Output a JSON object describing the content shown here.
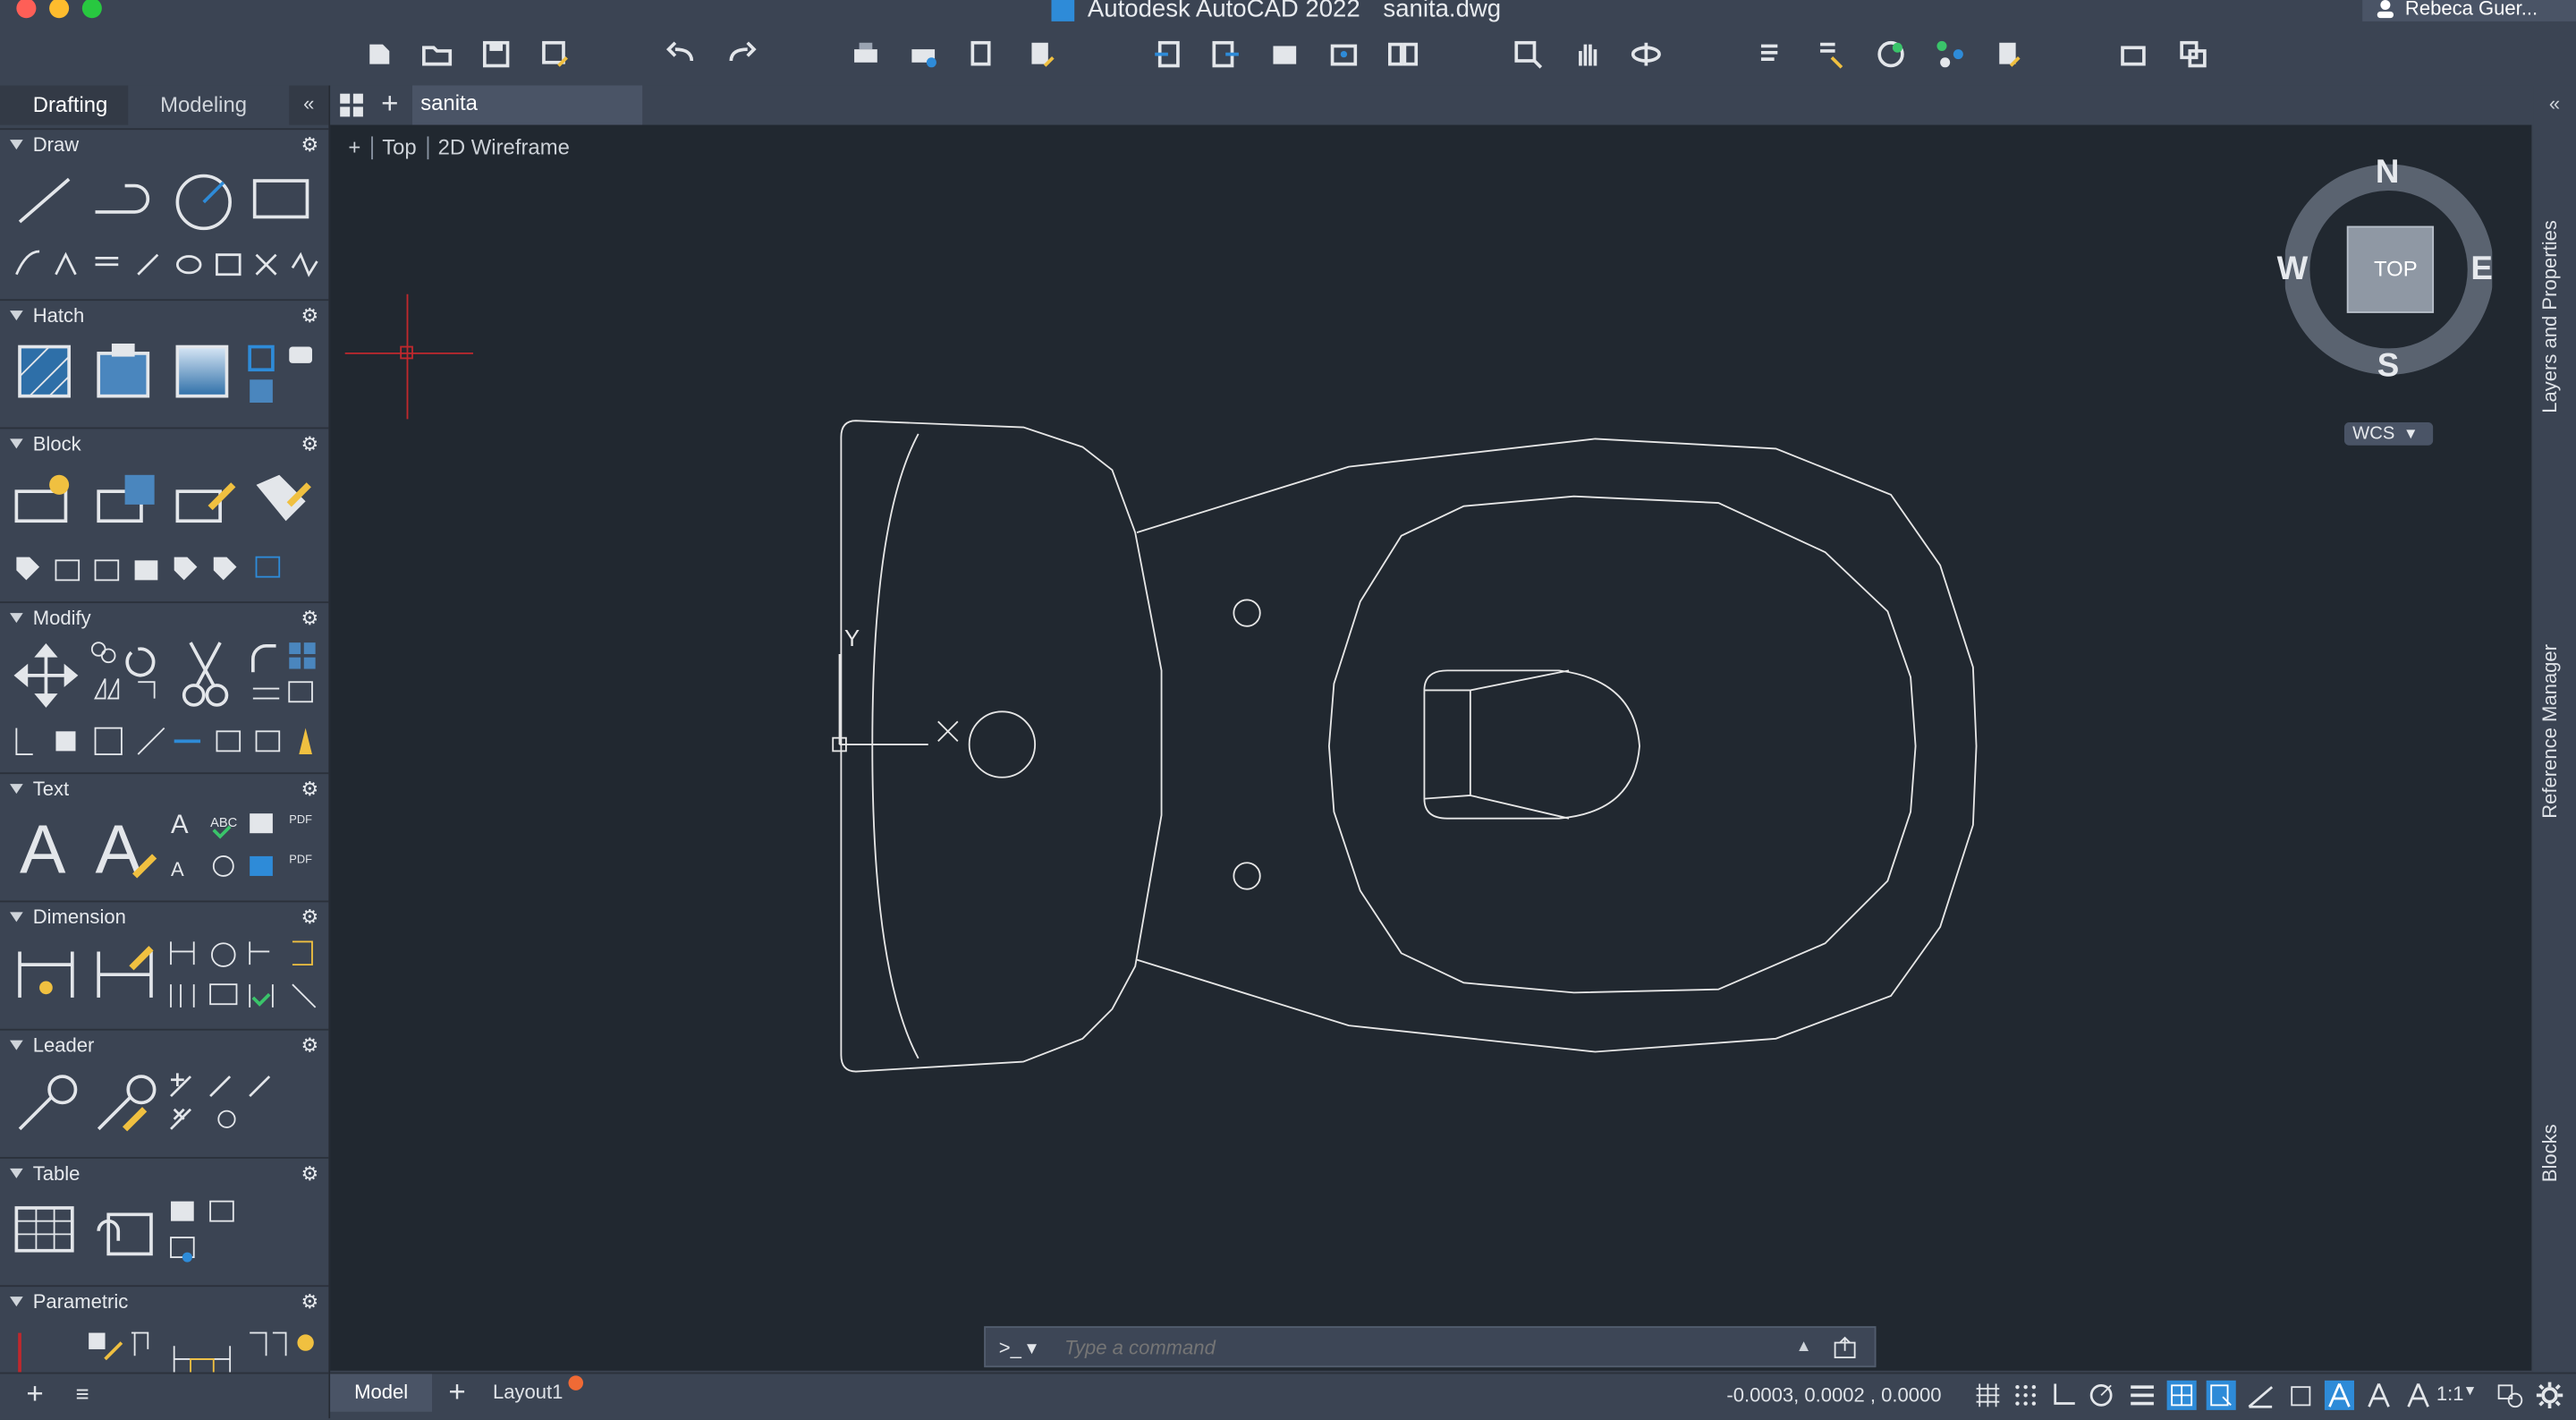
{
  "app": {
    "title": "Autodesk AutoCAD 2022",
    "document": "sanita.dwg",
    "user": "Rebeca Guer..."
  },
  "palette": {
    "tabs": [
      "Drafting",
      "Modeling"
    ],
    "active_tab": "Drafting",
    "collapse": "«",
    "sections": [
      {
        "label": "Draw"
      },
      {
        "label": "Hatch"
      },
      {
        "label": "Block"
      },
      {
        "label": "Modify"
      },
      {
        "label": "Text"
      },
      {
        "label": "Dimension"
      },
      {
        "label": "Leader"
      },
      {
        "label": "Table"
      },
      {
        "label": "Parametric"
      }
    ]
  },
  "file_tab": {
    "name": "sanita"
  },
  "viewport": {
    "plus": "+",
    "view": "Top",
    "style": "2D Wireframe"
  },
  "viewcube": {
    "face": "TOP",
    "north": "N",
    "south": "S",
    "east": "E",
    "west": "W",
    "ucs": "WCS"
  },
  "right_rail": [
    "Layers and Properties",
    "Reference Manager",
    "Blocks"
  ],
  "command": {
    "prompt": ">_",
    "placeholder": "Type a command"
  },
  "status": {
    "model_tab": "Model",
    "layout_tab": "Layout1",
    "coordinates": "-0.0003, 0.0002 , 0.0000",
    "scale": "1:1"
  },
  "ucs_labels": {
    "y": "Y"
  },
  "colors": {
    "canvas": "#212830",
    "panel": "#3b4453",
    "crosshair": "#c0282d",
    "accent": "#2e8bd8",
    "line": "#e6e6e6"
  }
}
